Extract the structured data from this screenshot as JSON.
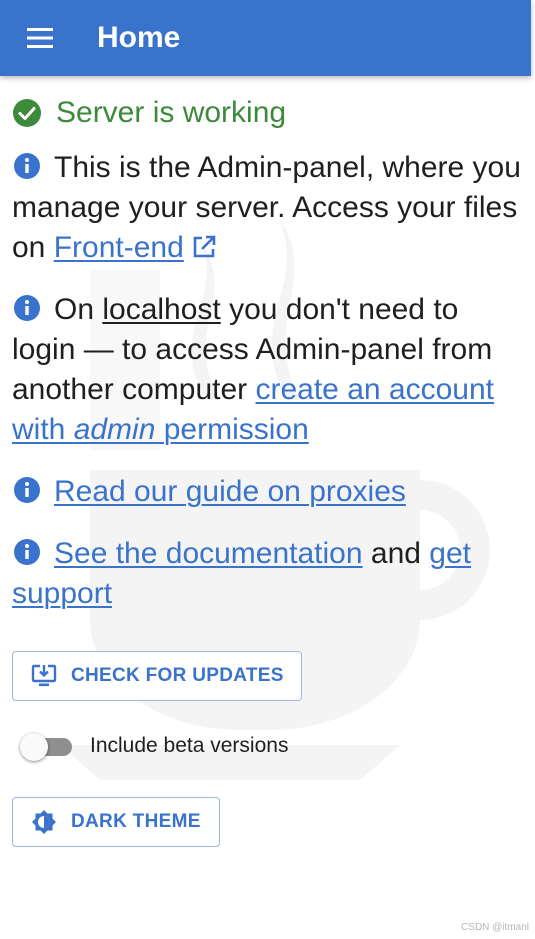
{
  "appbar": {
    "title": "Home",
    "menu_icon": "hamburger-menu-icon"
  },
  "status": {
    "text": "Server is working",
    "icon": "check-circle-icon",
    "color": "#3c8a3a"
  },
  "info1": {
    "icon": "info-icon",
    "text_before": "This is the Admin-panel, where you manage your server. Access your files on ",
    "link_text": "Front-end",
    "link_icon": "external-link-icon"
  },
  "info2": {
    "icon": "info-icon",
    "text_on": "On ",
    "localhost": "localhost",
    "text_middle": " you don't need to login — to access Admin-panel from another computer ",
    "link_part1": "create an account with ",
    "link_italic": "admin",
    "link_part2": " permission"
  },
  "info3": {
    "icon": "info-icon",
    "link_text": "Read our guide on proxies"
  },
  "info4": {
    "icon": "info-icon",
    "link_docs": "See the documentation",
    "text_and": " and ",
    "link_support": "get support"
  },
  "updates_button": {
    "label": "CHECK FOR UPDATES",
    "icon": "download-monitor-icon"
  },
  "beta_toggle": {
    "label": "Include beta versions",
    "state": "off"
  },
  "theme_button": {
    "label": "DARK THEME",
    "icon": "brightness-icon"
  },
  "credit": "CSDN @itmanl",
  "colors": {
    "primary": "#3a73cc",
    "success": "#3c8a3a",
    "text": "#1f1f1f"
  }
}
